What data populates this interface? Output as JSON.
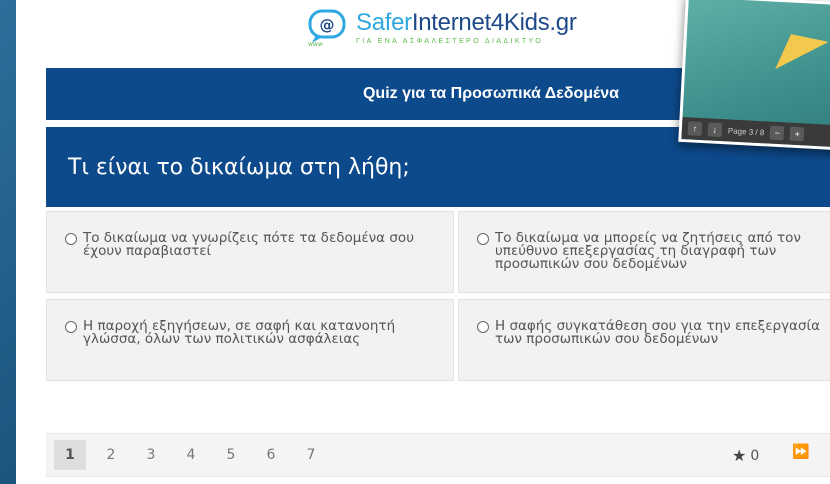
{
  "logo": {
    "mark_text": "@",
    "mark_sub": "www",
    "title_part1": "Safer",
    "title_part2": "Internet",
    "title_part3": "4Kids.gr",
    "tagline": "ΓΙΑ ΕΝΑ ΑΣΦΑΛΕΣΤΕΡΟ ΔΙΑΔΙΚΤΥΟ"
  },
  "quiz": {
    "title": "Quiz για τα Προσωπικά Δεδομένα",
    "question": "Τι είναι το δικαίωμα στη λήθη;",
    "answers": [
      {
        "label": "Το δικαίωμα να γνωρίζεις πότε τα δεδομένα σου έχουν παραβιαστεί"
      },
      {
        "label": "Το δικαίωμα να μπορείς να ζητήσεις από τον υπεύθυνο επεξεργασίας τη διαγραφή των προσωπικών σου δεδομένων"
      },
      {
        "label": "Η παροχή εξηγήσεων, σε σαφή και κατανοητή γλώσσα, όλων των πολιτικών ασφάλειας"
      },
      {
        "label": "Η σαφής συγκατάθεση σου για την επεξεργασία των προσωπικών σου δεδομένων"
      }
    ]
  },
  "pager": {
    "pages": [
      "1",
      "2",
      "3",
      "4",
      "5",
      "6",
      "7"
    ],
    "active_page": "1",
    "stars": "0",
    "star_icon": "star-icon",
    "next_icon": "skip-forward-icon"
  },
  "overlay": {
    "page_label": "Page 3 / 8",
    "up_icon": "arrow-up-icon",
    "down_icon": "arrow-down-icon",
    "zoom_out": "−",
    "zoom_in": "+"
  },
  "colors": {
    "brand_blue": "#0d4a8c",
    "logo_light_blue": "#2fa8e0",
    "logo_dark_blue": "#1e4a8a",
    "logo_green": "#5bb84a",
    "answer_bg": "#f2f2f2"
  }
}
